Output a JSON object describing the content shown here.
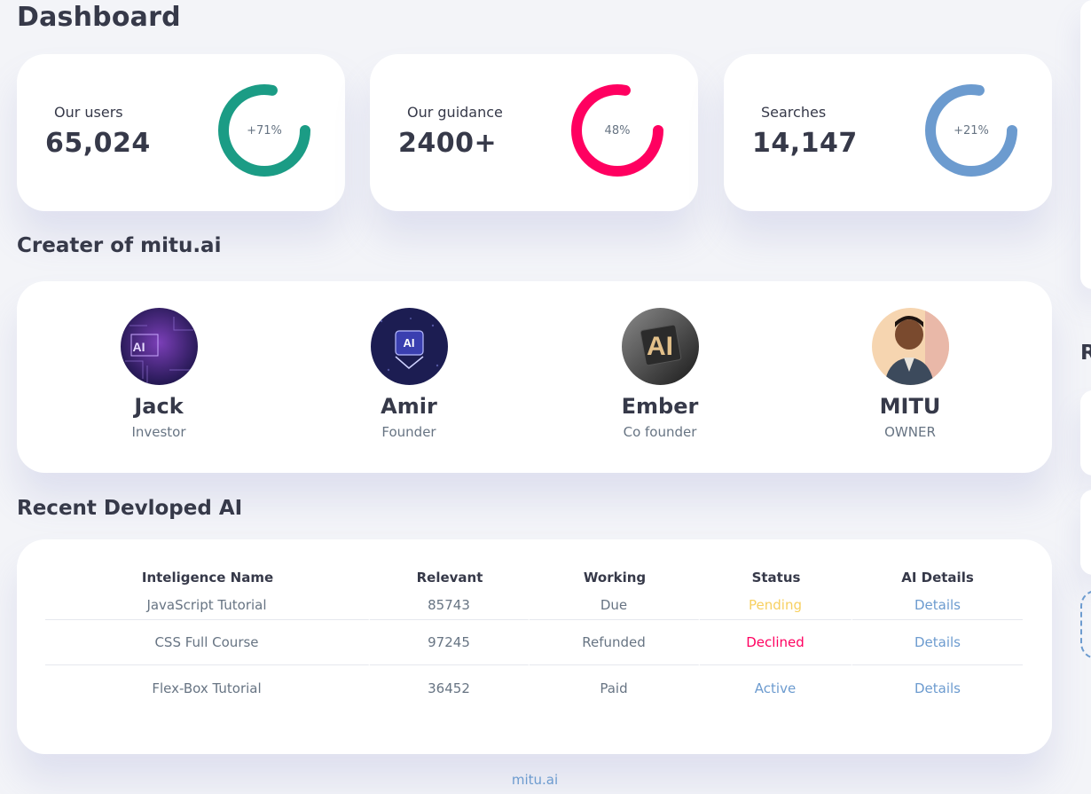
{
  "header": {
    "title": "Dashboard"
  },
  "stats": [
    {
      "label": "Our users",
      "value": "65,024",
      "percent_label": "+71%",
      "percent": 71,
      "color": "#1b9c85"
    },
    {
      "label": "Our guidance",
      "value": "2400+",
      "percent_label": "48%",
      "percent": 48,
      "color": "#ff0060"
    },
    {
      "label": "Searches",
      "value": "14,147",
      "percent_label": "+21%",
      "percent": 21,
      "color": "#6c9bcf"
    }
  ],
  "creators_section": {
    "title": "Creater of mitu.ai",
    "members": [
      {
        "name": "Jack",
        "role": "Investor",
        "avatar_text": "AI"
      },
      {
        "name": "Amir",
        "role": "Founder",
        "avatar_text": "AI"
      },
      {
        "name": "Ember",
        "role": "Co founder",
        "avatar_text": "AI"
      },
      {
        "name": "MITU",
        "role": "OWNER",
        "avatar_text": ""
      }
    ]
  },
  "recent_section": {
    "title": "Recent Devloped AI",
    "columns": [
      "Inteligence Name",
      "Relevant",
      "Working",
      "Status",
      "AI Details"
    ],
    "rows": [
      {
        "name": "JavaScript Tutorial",
        "relevant": "85743",
        "working": "Due",
        "status": "Pending",
        "status_color": "#f7d060",
        "details": "Details"
      },
      {
        "name": "CSS Full Course",
        "relevant": "97245",
        "working": "Refunded",
        "status": "Declined",
        "status_color": "#ff0060",
        "details": "Details"
      },
      {
        "name": "Flex-Box Tutorial",
        "relevant": "36452",
        "working": "Paid",
        "status": "Active",
        "status_color": "#6c9bcf",
        "details": "Details"
      }
    ]
  },
  "footer": {
    "link": "mitu.ai"
  },
  "side": {
    "heading_initial": "R"
  }
}
